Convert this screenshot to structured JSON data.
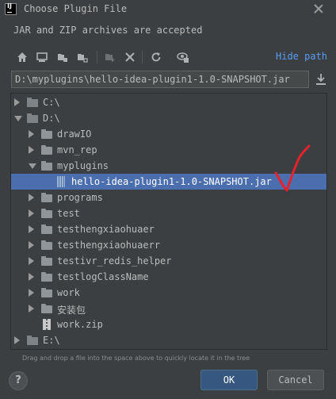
{
  "window": {
    "title": "Choose Plugin File",
    "description": "JAR and ZIP archives are accepted"
  },
  "toolbar": {
    "buttons": [
      "home-icon",
      "desktop-icon",
      "project-icon",
      "module-icon",
      "new-folder-icon",
      "delete-icon",
      "refresh-icon",
      "show-hidden-icon"
    ],
    "hide_path_label": "Hide path"
  },
  "path": {
    "value": "D:\\myplugins\\hello-idea-plugin1-1.0-SNAPSHOT.jar"
  },
  "tree": {
    "rows": [
      {
        "label": "C:\\",
        "type": "drive",
        "state": "collapsed",
        "depth": 0
      },
      {
        "label": "D:\\",
        "type": "drive",
        "state": "expanded",
        "depth": 0
      },
      {
        "label": "drawIO",
        "type": "folder",
        "state": "collapsed",
        "depth": 1
      },
      {
        "label": "mvn_rep",
        "type": "folder",
        "state": "collapsed",
        "depth": 1
      },
      {
        "label": "myplugins",
        "type": "folder",
        "state": "expanded",
        "depth": 1
      },
      {
        "label": "hello-idea-plugin1-1.0-SNAPSHOT.jar",
        "type": "jar",
        "state": "leaf",
        "depth": 2,
        "selected": true
      },
      {
        "label": "programs",
        "type": "folder",
        "state": "collapsed",
        "depth": 1
      },
      {
        "label": "test",
        "type": "folder",
        "state": "collapsed",
        "depth": 1
      },
      {
        "label": "testhengxiaohuaer",
        "type": "folder",
        "state": "collapsed",
        "depth": 1
      },
      {
        "label": "testhengxiaohuaerr",
        "type": "folder",
        "state": "collapsed",
        "depth": 1
      },
      {
        "label": "testivr_redis_helper",
        "type": "folder",
        "state": "collapsed",
        "depth": 1
      },
      {
        "label": "testlogClassName",
        "type": "folder",
        "state": "collapsed",
        "depth": 1
      },
      {
        "label": "work",
        "type": "folder",
        "state": "collapsed",
        "depth": 1
      },
      {
        "label": "安装包",
        "type": "folder",
        "state": "collapsed",
        "depth": 1
      },
      {
        "label": "work.zip",
        "type": "zip",
        "state": "leaf",
        "depth": 1
      },
      {
        "label": "E:\\",
        "type": "drive",
        "state": "collapsed",
        "depth": 0
      }
    ]
  },
  "hint": "Drag and drop a file into the space above to quickly locate it in the tree",
  "buttons": {
    "help": "?",
    "ok": "OK",
    "cancel": "Cancel"
  },
  "colors": {
    "background": "#3c3f41",
    "selection": "#4b6eaf",
    "link": "#589df6",
    "annotation": "#e8212a"
  }
}
